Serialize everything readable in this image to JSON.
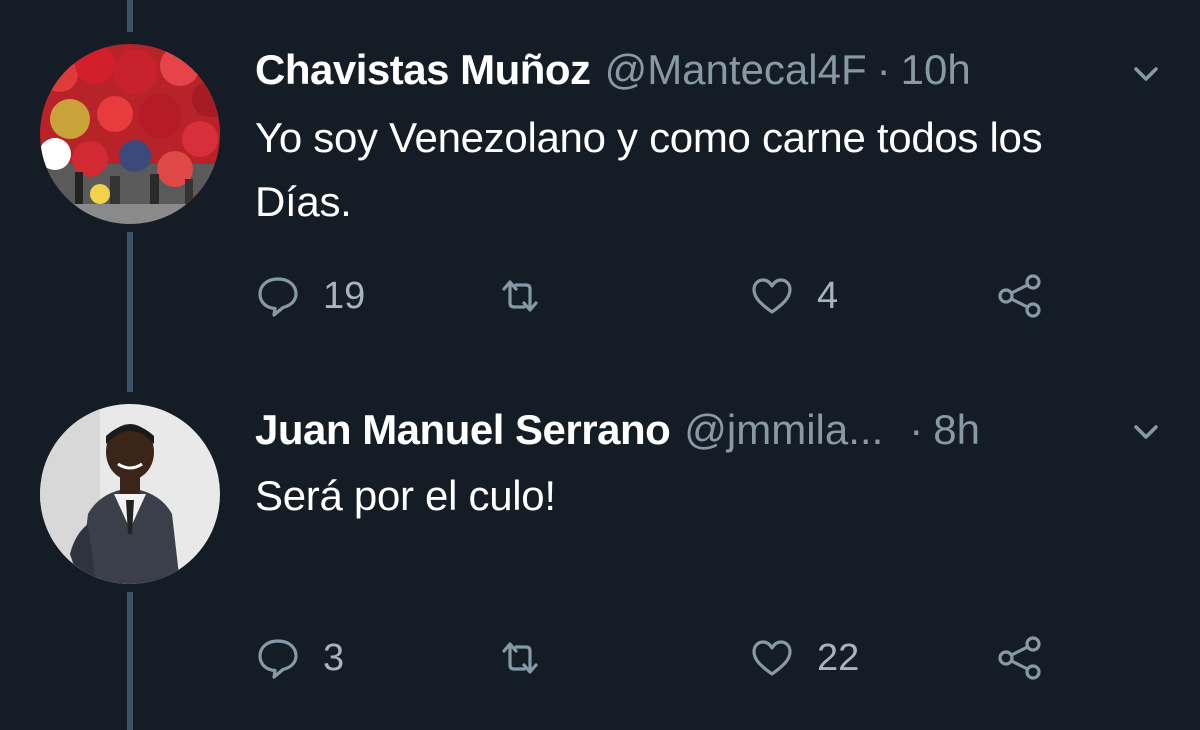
{
  "tweets": [
    {
      "name": "Chavistas Muñoz",
      "handle": "@Mantecal4F",
      "separator": "·",
      "time": "10h",
      "text": "Yo soy Venezolano y como carne todos los Días.",
      "replies": "19",
      "retweets": "",
      "likes": "4",
      "avatar": "crowd-photo"
    },
    {
      "name": "Juan Manuel Serrano",
      "handle": "@jmmila...",
      "separator": "·",
      "time": "8h",
      "text": "Será por el culo!",
      "replies": "3",
      "retweets": "",
      "likes": "22",
      "avatar": "man-in-suit-photo"
    }
  ],
  "icons": {
    "reply": "speech-bubble-icon",
    "retweet": "retweet-arrows-icon",
    "like": "heart-outline-icon",
    "share": "share-nodes-icon",
    "menu": "chevron-down-icon"
  },
  "colors": {
    "background": "#141d26",
    "thread_line": "#3d5466",
    "secondary_text": "#8899a6"
  }
}
